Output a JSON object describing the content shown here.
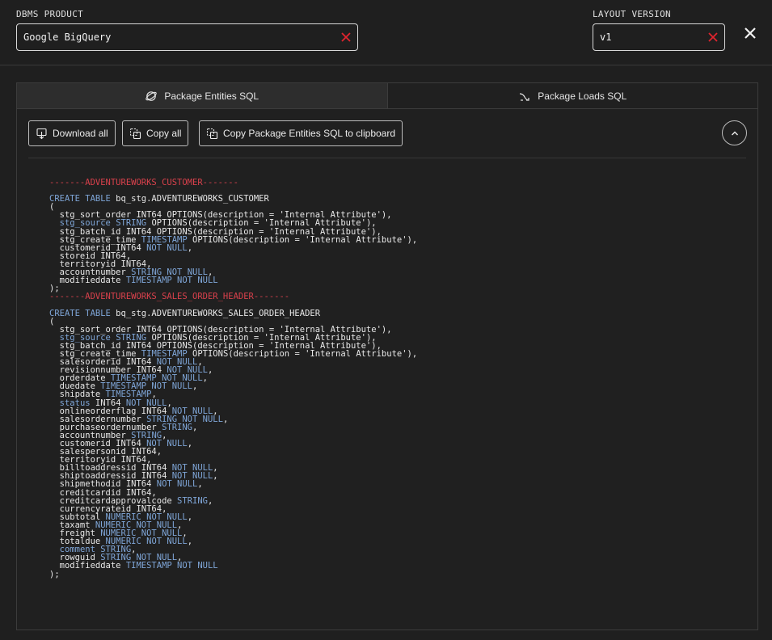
{
  "header": {
    "dbms_label": "DBMS PRODUCT",
    "dbms_value": "Google BigQuery",
    "layout_label": "LAYOUT VERSION",
    "layout_value": "v1"
  },
  "tabs": [
    {
      "label": "Package Entities SQL",
      "active": true,
      "icon": "entities-icon"
    },
    {
      "label": "Package Loads SQL",
      "active": false,
      "icon": "loads-icon"
    }
  ],
  "toolbar": {
    "download_label": "Download all",
    "copy_all_label": "Copy all",
    "copy_clipboard_label": "Copy Package Entities SQL to clipboard"
  },
  "colors": {
    "background": "#1f1f1f",
    "clear_icon": "#e0242e",
    "comment": "#d9414c",
    "keyword": "#7fa6d8"
  },
  "sql_lines": [
    [
      [
        "cm",
        "-------ADVENTUREWORKS_CUSTOMER-------"
      ]
    ],
    [
      [
        "t",
        ""
      ]
    ],
    [
      [
        "kw",
        "CREATE TABLE"
      ],
      [
        "t",
        " bq_stg.ADVENTUREWORKS_CUSTOMER"
      ]
    ],
    [
      [
        "t",
        "("
      ]
    ],
    [
      [
        "t",
        "  stg_sort_order INT64 OPTIONS(description = 'Internal Attribute'),"
      ]
    ],
    [
      [
        "t",
        "  "
      ],
      [
        "kw",
        "stg_source STRING"
      ],
      [
        "t",
        " OPTIONS(description = 'Internal Attribute'),"
      ]
    ],
    [
      [
        "t",
        "  stg_batch_id INT64 OPTIONS(description = 'Internal Attribute'),"
      ]
    ],
    [
      [
        "t",
        "  stg_create_time "
      ],
      [
        "kw",
        "TIMESTAMP"
      ],
      [
        "t",
        " OPTIONS(description = 'Internal Attribute'),"
      ]
    ],
    [
      [
        "t",
        "  customerid INT64 "
      ],
      [
        "kw",
        "NOT NULL"
      ],
      [
        "t",
        ","
      ]
    ],
    [
      [
        "t",
        "  storeid INT64,"
      ]
    ],
    [
      [
        "t",
        "  territoryid INT64,"
      ]
    ],
    [
      [
        "t",
        "  accountnumber "
      ],
      [
        "kw",
        "STRING NOT NULL"
      ],
      [
        "t",
        ","
      ]
    ],
    [
      [
        "t",
        "  modifieddate "
      ],
      [
        "kw",
        "TIMESTAMP NOT NULL"
      ]
    ],
    [
      [
        "t",
        ");"
      ]
    ],
    [
      [
        "cm",
        "-------ADVENTUREWORKS_SALES_ORDER_HEADER-------"
      ]
    ],
    [
      [
        "t",
        ""
      ]
    ],
    [
      [
        "kw",
        "CREATE TABLE"
      ],
      [
        "t",
        " bq_stg.ADVENTUREWORKS_SALES_ORDER_HEADER"
      ]
    ],
    [
      [
        "t",
        "("
      ]
    ],
    [
      [
        "t",
        "  stg_sort_order INT64 OPTIONS(description = 'Internal Attribute'),"
      ]
    ],
    [
      [
        "t",
        "  "
      ],
      [
        "kw",
        "stg_source STRING"
      ],
      [
        "t",
        " OPTIONS(description = 'Internal Attribute'),"
      ]
    ],
    [
      [
        "t",
        "  stg_batch_id INT64 OPTIONS(description = 'Internal Attribute'),"
      ]
    ],
    [
      [
        "t",
        "  stg_create_time "
      ],
      [
        "kw",
        "TIMESTAMP"
      ],
      [
        "t",
        " OPTIONS(description = 'Internal Attribute'),"
      ]
    ],
    [
      [
        "t",
        "  salesorderid INT64 "
      ],
      [
        "kw",
        "NOT NULL"
      ],
      [
        "t",
        ","
      ]
    ],
    [
      [
        "t",
        "  revisionnumber INT64 "
      ],
      [
        "kw",
        "NOT NULL"
      ],
      [
        "t",
        ","
      ]
    ],
    [
      [
        "t",
        "  orderdate "
      ],
      [
        "kw",
        "TIMESTAMP NOT NULL"
      ],
      [
        "t",
        ","
      ]
    ],
    [
      [
        "t",
        "  duedate "
      ],
      [
        "kw",
        "TIMESTAMP NOT NULL"
      ],
      [
        "t",
        ","
      ]
    ],
    [
      [
        "t",
        "  shipdate "
      ],
      [
        "kw",
        "TIMESTAMP"
      ],
      [
        "t",
        ","
      ]
    ],
    [
      [
        "t",
        "  "
      ],
      [
        "kw",
        "status"
      ],
      [
        "t",
        " INT64 "
      ],
      [
        "kw",
        "NOT NULL"
      ],
      [
        "t",
        ","
      ]
    ],
    [
      [
        "t",
        "  onlineorderflag INT64 "
      ],
      [
        "kw",
        "NOT NULL"
      ],
      [
        "t",
        ","
      ]
    ],
    [
      [
        "t",
        "  salesordernumber "
      ],
      [
        "kw",
        "STRING NOT NULL"
      ],
      [
        "t",
        ","
      ]
    ],
    [
      [
        "t",
        "  purchaseordernumber "
      ],
      [
        "kw",
        "STRING"
      ],
      [
        "t",
        ","
      ]
    ],
    [
      [
        "t",
        "  accountnumber "
      ],
      [
        "kw",
        "STRING"
      ],
      [
        "t",
        ","
      ]
    ],
    [
      [
        "t",
        "  customerid INT64 "
      ],
      [
        "kw",
        "NOT NULL"
      ],
      [
        "t",
        ","
      ]
    ],
    [
      [
        "t",
        "  salespersonid INT64,"
      ]
    ],
    [
      [
        "t",
        "  territoryid INT64,"
      ]
    ],
    [
      [
        "t",
        "  billtoaddressid INT64 "
      ],
      [
        "kw",
        "NOT NULL"
      ],
      [
        "t",
        ","
      ]
    ],
    [
      [
        "t",
        "  shiptoaddressid INT64 "
      ],
      [
        "kw",
        "NOT NULL"
      ],
      [
        "t",
        ","
      ]
    ],
    [
      [
        "t",
        "  shipmethodid INT64 "
      ],
      [
        "kw",
        "NOT NULL"
      ],
      [
        "t",
        ","
      ]
    ],
    [
      [
        "t",
        "  creditcardid INT64,"
      ]
    ],
    [
      [
        "t",
        "  creditcardapprovalcode "
      ],
      [
        "kw",
        "STRING"
      ],
      [
        "t",
        ","
      ]
    ],
    [
      [
        "t",
        "  currencyrateid INT64,"
      ]
    ],
    [
      [
        "t",
        "  subtotal "
      ],
      [
        "kw",
        "NUMERIC NOT NULL"
      ],
      [
        "t",
        ","
      ]
    ],
    [
      [
        "t",
        "  taxamt "
      ],
      [
        "kw",
        "NUMERIC NOT NULL"
      ],
      [
        "t",
        ","
      ]
    ],
    [
      [
        "t",
        "  freight "
      ],
      [
        "kw",
        "NUMERIC NOT NULL"
      ],
      [
        "t",
        ","
      ]
    ],
    [
      [
        "t",
        "  totaldue "
      ],
      [
        "kw",
        "NUMERIC NOT NULL"
      ],
      [
        "t",
        ","
      ]
    ],
    [
      [
        "t",
        "  "
      ],
      [
        "kw",
        "comment STRING"
      ],
      [
        "t",
        ","
      ]
    ],
    [
      [
        "t",
        "  rowguid "
      ],
      [
        "kw",
        "STRING NOT NULL"
      ],
      [
        "t",
        ","
      ]
    ],
    [
      [
        "t",
        "  modifieddate "
      ],
      [
        "kw",
        "TIMESTAMP NOT NULL"
      ]
    ],
    [
      [
        "t",
        ");"
      ]
    ]
  ]
}
